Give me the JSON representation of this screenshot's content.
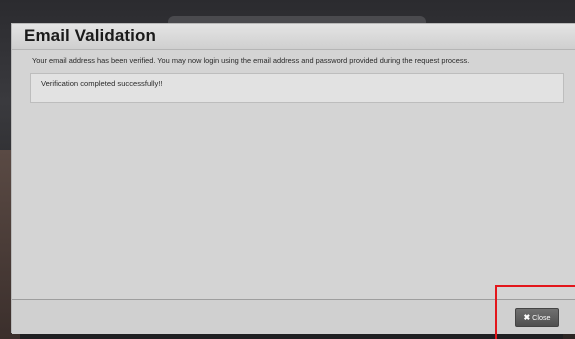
{
  "dialog": {
    "title": "Email Validation",
    "message": "Your email address has been verified. You may now login using the email address and password provided during the request process.",
    "success_text": "Verification completed successfully!!"
  },
  "footer": {
    "close_label": "Close",
    "close_icon_glyph": "✖"
  },
  "annotation": {
    "highlight_color": "#e3161b"
  }
}
